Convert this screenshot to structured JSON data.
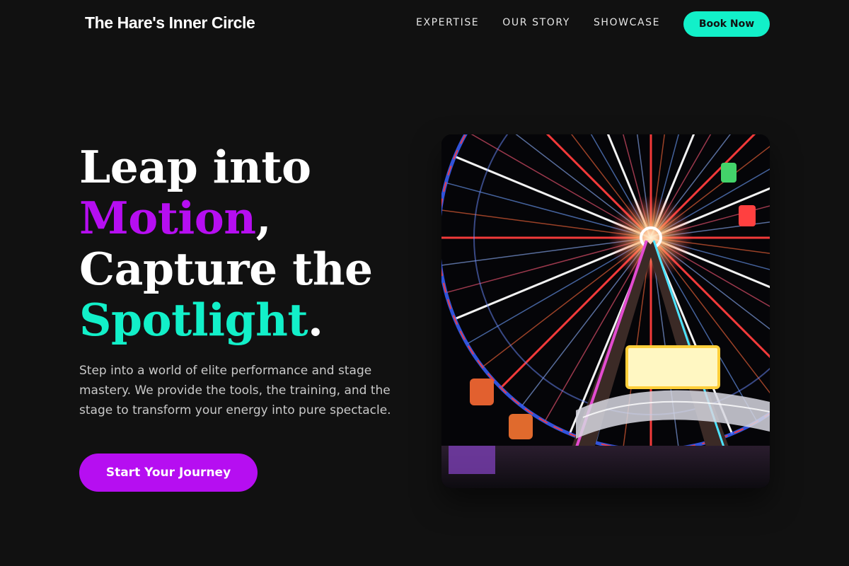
{
  "nav": {
    "brand": "The Hare's Inner Circle",
    "links": [
      {
        "label": "EXPERTISE"
      },
      {
        "label": "OUR STORY"
      },
      {
        "label": "SHOWCASE"
      }
    ],
    "cta_label": "Book Now"
  },
  "hero": {
    "title": {
      "line1": "Leap into",
      "word_motion": "Motion",
      "comma": ",",
      "line3": "Capture the",
      "word_spotlight": "Spotlight",
      "period": "."
    },
    "description": "Step into a world of elite performance and stage mastery. We provide the tools, the training, and the stage to transform your energy into pure spectacle.",
    "cta_label": "Start Your Journey",
    "image_alt": "Illuminated ferris wheel at night"
  },
  "colors": {
    "background": "#111111",
    "accent_teal": "#12f0c9",
    "accent_purple": "#b60ef1"
  }
}
